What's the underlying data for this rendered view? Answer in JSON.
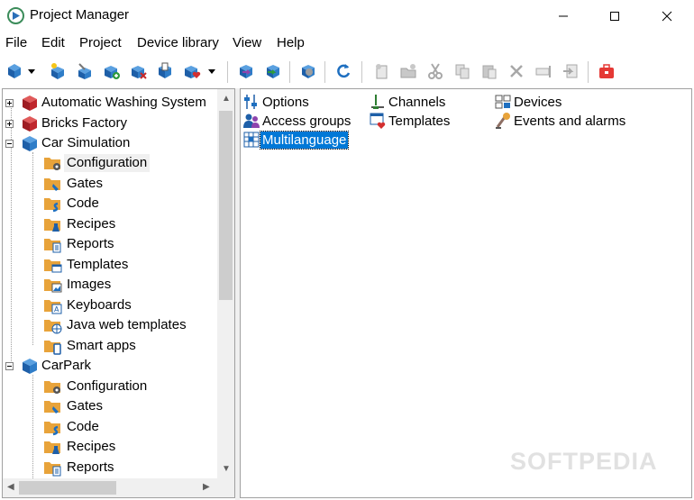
{
  "window": {
    "title": "Project Manager"
  },
  "menu": [
    "File",
    "Edit",
    "Project",
    "Device library",
    "View",
    "Help"
  ],
  "tree": [
    {
      "label": "Automatic Washing System",
      "kind": "project-red",
      "expanded": false
    },
    {
      "label": "Bricks Factory",
      "kind": "project-red",
      "expanded": false
    },
    {
      "label": "Car Simulation",
      "kind": "project-blue",
      "expanded": true
    },
    {
      "label": "Configuration",
      "kind": "folder-config",
      "selected": true
    },
    {
      "label": "Gates",
      "kind": "folder-gates"
    },
    {
      "label": "Code",
      "kind": "folder-code"
    },
    {
      "label": "Recipes",
      "kind": "folder-recipes"
    },
    {
      "label": "Reports",
      "kind": "folder-reports"
    },
    {
      "label": "Templates",
      "kind": "folder-templates"
    },
    {
      "label": "Images",
      "kind": "folder-images"
    },
    {
      "label": "Keyboards",
      "kind": "folder-keyboards"
    },
    {
      "label": "Java web templates",
      "kind": "folder-web"
    },
    {
      "label": "Smart apps",
      "kind": "folder-apps"
    },
    {
      "label": "CarPark",
      "kind": "project-blue",
      "expanded": true
    },
    {
      "label": "Configuration",
      "kind": "folder-config"
    },
    {
      "label": "Gates",
      "kind": "folder-gates"
    },
    {
      "label": "Code",
      "kind": "folder-code"
    },
    {
      "label": "Recipes",
      "kind": "folder-recipes"
    },
    {
      "label": "Reports",
      "kind": "folder-reports"
    }
  ],
  "content_items": [
    {
      "label": "Options",
      "icon": "options-icon"
    },
    {
      "label": "Channels",
      "icon": "channels-icon"
    },
    {
      "label": "Devices",
      "icon": "devices-icon"
    },
    {
      "label": "Access groups",
      "icon": "access-groups-icon"
    },
    {
      "label": "Templates",
      "icon": "templates-icon"
    },
    {
      "label": "Events and alarms",
      "icon": "events-alarms-icon"
    },
    {
      "label": "Multilanguage",
      "icon": "multilanguage-icon",
      "selected": true
    }
  ],
  "watermark": "SOFTPEDIA",
  "colors": {
    "selection": "#0078d7",
    "project_blue": "#1e73be",
    "project_red": "#c0272d",
    "folder": "#e8a33a"
  }
}
